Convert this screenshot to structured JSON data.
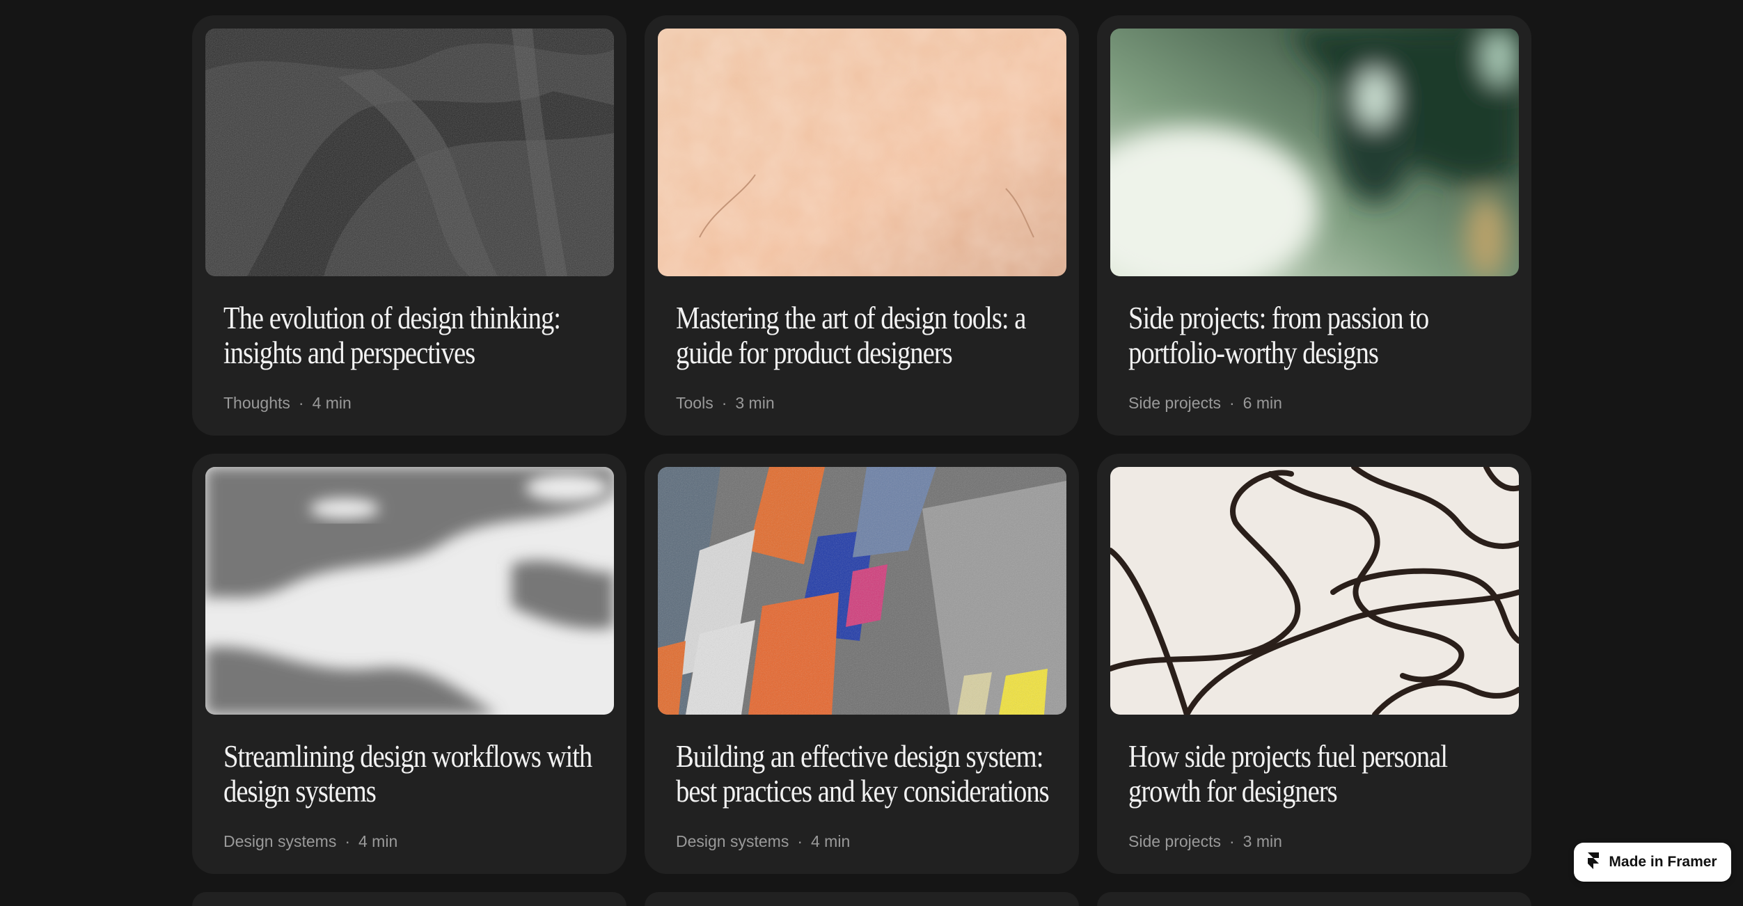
{
  "posts": [
    {
      "title": "The evolution of design thinking: insights and perspectives",
      "category": "Thoughts",
      "read_time": "4 min",
      "image": "dark-charcoal-brushstroke-texture"
    },
    {
      "title": "Mastering the art of design tools: a guide for product designers",
      "category": "Tools",
      "read_time": "3 min",
      "image": "peach-stone-texture"
    },
    {
      "title": "Side projects: from passion to portfolio-worthy designs",
      "category": "Side projects",
      "read_time": "6 min",
      "image": "blurred-green-foliage"
    },
    {
      "title": "Streamlining design workflows with design systems",
      "category": "Design systems",
      "read_time": "4 min",
      "image": "leaf-shadow-on-white-wall"
    },
    {
      "title": "Building an effective design system: best practices and key considerations",
      "category": "Design systems",
      "read_time": "4 min",
      "image": "abstract-colorful-pastel-strokes"
    },
    {
      "title": "How side projects fuel personal growth for designers",
      "category": "Side projects",
      "read_time": "3 min",
      "image": "black-ink-loops-on-cream"
    }
  ],
  "separator": "·",
  "badge": {
    "label": "Made in Framer",
    "icon": "framer-logo-icon"
  },
  "colors": {
    "background": "#151515",
    "card": "#212121",
    "title": "#f2f2f2",
    "meta": "#9a9a9a"
  }
}
